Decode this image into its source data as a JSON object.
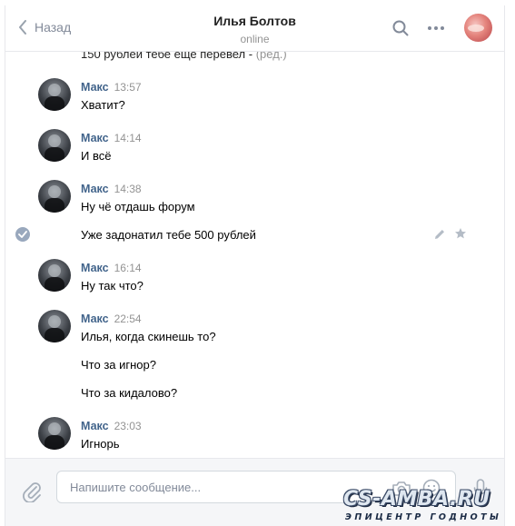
{
  "header": {
    "back_label": "Назад",
    "contact_name": "Илья Болтов",
    "contact_status": "online"
  },
  "partial_message": {
    "text": "150 рублей тебе еще перевел -",
    "edited": "(ред.)"
  },
  "messages": [
    {
      "author": "Макс",
      "time": "13:57",
      "lines": [
        "Хватит?"
      ]
    },
    {
      "author": "Макс",
      "time": "14:14",
      "lines": [
        "И всё"
      ]
    },
    {
      "author": "Макс",
      "time": "14:38",
      "lines": [
        "Ну чё отдашь форум"
      ]
    },
    {
      "author": "",
      "time": "",
      "lines": [
        "Уже задонатил тебе 500 рублей"
      ]
    },
    {
      "author": "Макс",
      "time": "16:14",
      "lines": [
        "Ну так что?"
      ]
    },
    {
      "author": "Макс",
      "time": "22:54",
      "lines": [
        "Илья, когда скинешь то?",
        "Что за игнор?",
        "Что за кидалово?"
      ]
    },
    {
      "author": "Макс",
      "time": "23:03",
      "lines": [
        "Игнорь"
      ]
    }
  ],
  "composer": {
    "placeholder": "Напишите сообщение..."
  },
  "watermark": {
    "logo": "CS-AMBA.RU",
    "tagline": "ЭПИЦЕНТР ГОДНОТЫ"
  },
  "colors": {
    "author": "#42648b",
    "meta": "#939393",
    "accent_check": "#99a8bd",
    "composer_bg": "#f5f6f8"
  }
}
